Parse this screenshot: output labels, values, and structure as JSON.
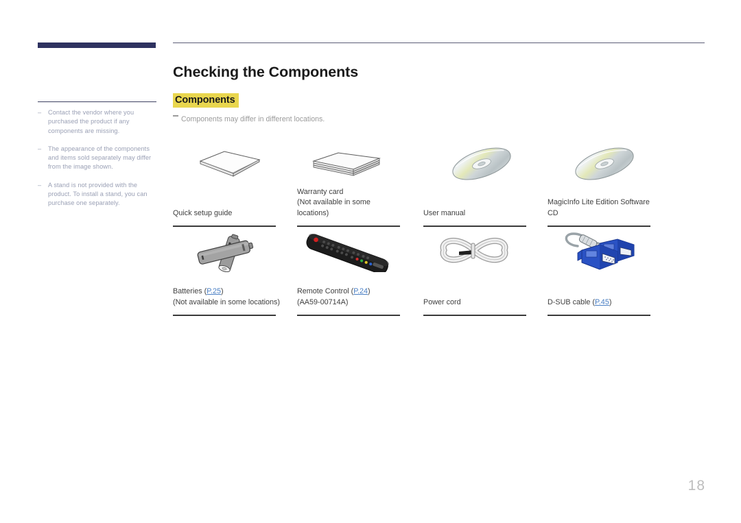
{
  "document": {
    "page_number": "18"
  },
  "sidebar": {
    "notes": [
      {
        "dash": "–",
        "text": "Contact the vendor where you purchased the product if any components are missing."
      },
      {
        "dash": "–",
        "text": "The appearance of the components and items sold separately may differ from the image shown."
      },
      {
        "dash": "–",
        "text": "A stand is not provided with the product. To install a stand, you can purchase one separately."
      }
    ]
  },
  "main": {
    "title": "Checking the Components",
    "section_title": "Components",
    "sub_note": "Components may differ in different locations."
  },
  "components": {
    "rows": [
      [
        {
          "icon": "booklet-icon",
          "name": "quick-setup-guide",
          "label1": "Quick setup guide",
          "label2": "",
          "link": "",
          "label3": ""
        },
        {
          "icon": "card-stack-icon",
          "name": "warranty-card",
          "label1": "Warranty card",
          "label2": "(Not available in some locations)",
          "link": "",
          "label3": ""
        },
        {
          "icon": "cd-disc-icon",
          "name": "user-manual",
          "label1": "User manual",
          "label2": "",
          "link": "",
          "label3": ""
        },
        {
          "icon": "cd-disc-icon",
          "name": "magicinfo-software-cd",
          "label1": "MagicInfo Lite Edition Software CD",
          "label2": "",
          "link": "",
          "label3": ""
        }
      ],
      [
        {
          "icon": "batteries-icon",
          "name": "batteries",
          "label1": "Batteries (",
          "link": "P.25",
          "label1_end": ")",
          "label2": "(Not available in some locations)",
          "label3": ""
        },
        {
          "icon": "remote-control-icon",
          "name": "remote-control",
          "label1": "Remote Control (",
          "link": "P.24",
          "label1_end": ")",
          "label2": "(AA59-00714A)",
          "label3": ""
        },
        {
          "icon": "power-cord-icon",
          "name": "power-cord",
          "label1": "Power cord",
          "link": "",
          "label1_end": "",
          "label2": "",
          "label3": ""
        },
        {
          "icon": "dsub-cable-icon",
          "name": "d-sub-cable",
          "label1": "D-SUB cable (",
          "link": "P.45",
          "label1_end": ")",
          "label2": "",
          "label3": ""
        }
      ]
    ]
  },
  "colors": {
    "accent_navy": "#2e3260",
    "highlight_yellow": "#e9d64e",
    "link_blue": "#4a7fc4",
    "note_grey": "#9aa0b5"
  }
}
